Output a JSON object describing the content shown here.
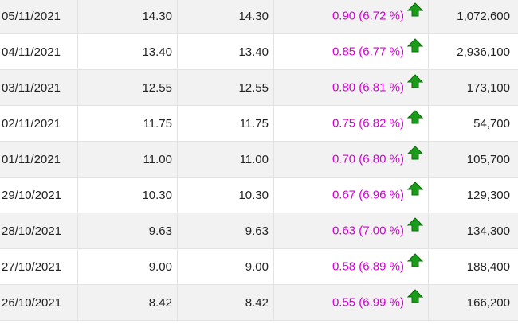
{
  "colors": {
    "change_text": "#d400d4",
    "up_arrow": "#1a9c1a",
    "row_alt_bg": "#f2f2f2",
    "row_plain_bg": "#ffffff",
    "grid_line": "#e3e3e3"
  },
  "icons": {
    "trend": "up-arrow-icon"
  },
  "rows": [
    {
      "date": "05/11/2021",
      "price_a": "14.30",
      "price_b": "14.30",
      "change": "0.90 (6.72 %)",
      "volume": "1,072,600"
    },
    {
      "date": "04/11/2021",
      "price_a": "13.40",
      "price_b": "13.40",
      "change": "0.85 (6.77 %)",
      "volume": "2,936,100"
    },
    {
      "date": "03/11/2021",
      "price_a": "12.55",
      "price_b": "12.55",
      "change": "0.80 (6.81 %)",
      "volume": "173,100"
    },
    {
      "date": "02/11/2021",
      "price_a": "11.75",
      "price_b": "11.75",
      "change": "0.75 (6.82 %)",
      "volume": "54,700"
    },
    {
      "date": "01/11/2021",
      "price_a": "11.00",
      "price_b": "11.00",
      "change": "0.70 (6.80 %)",
      "volume": "105,700"
    },
    {
      "date": "29/10/2021",
      "price_a": "10.30",
      "price_b": "10.30",
      "change": "0.67 (6.96 %)",
      "volume": "129,300"
    },
    {
      "date": "28/10/2021",
      "price_a": "9.63",
      "price_b": "9.63",
      "change": "0.63 (7.00 %)",
      "volume": "134,300"
    },
    {
      "date": "27/10/2021",
      "price_a": "9.00",
      "price_b": "9.00",
      "change": "0.58 (6.89 %)",
      "volume": "188,400"
    },
    {
      "date": "26/10/2021",
      "price_a": "8.42",
      "price_b": "8.42",
      "change": "0.55 (6.99 %)",
      "volume": "166,200"
    }
  ]
}
